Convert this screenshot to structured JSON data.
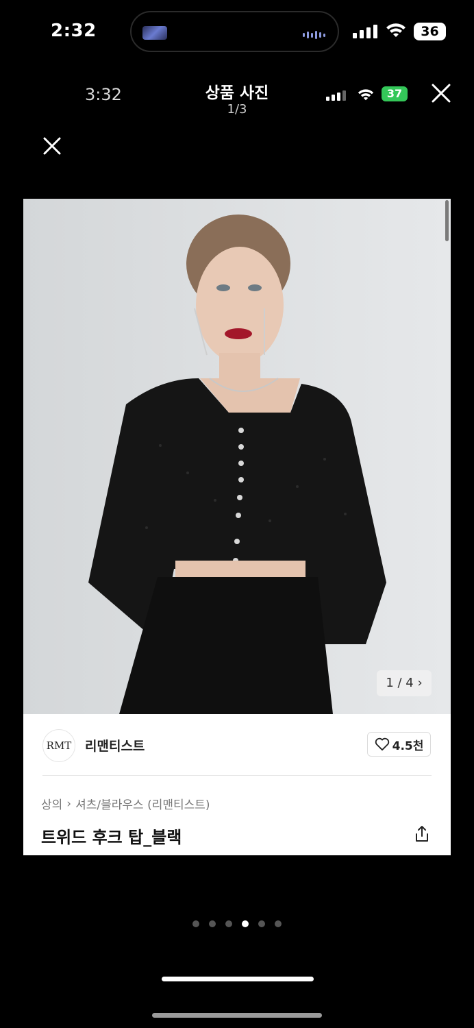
{
  "outer_status": {
    "time": "2:32",
    "battery": "36"
  },
  "inner_status": {
    "time": "3:32",
    "battery": "37"
  },
  "viewer": {
    "title": "상품 사진",
    "counter": "1/3"
  },
  "product": {
    "image_counter": "1 / 4",
    "brand_logo_text": "RMT",
    "brand_name": "리맨티스트",
    "like_count": "4.5천",
    "breadcrumb": [
      "상의",
      "셔츠/블라우스 (리맨티스트)"
    ],
    "title": "트위드 후크 탑_블랙"
  },
  "pager": {
    "total": 6,
    "active_index": 3
  },
  "icons": [
    "close-icon",
    "heart-icon",
    "share-icon",
    "chevron-right-icon",
    "wifi-icon",
    "signal-icon"
  ]
}
